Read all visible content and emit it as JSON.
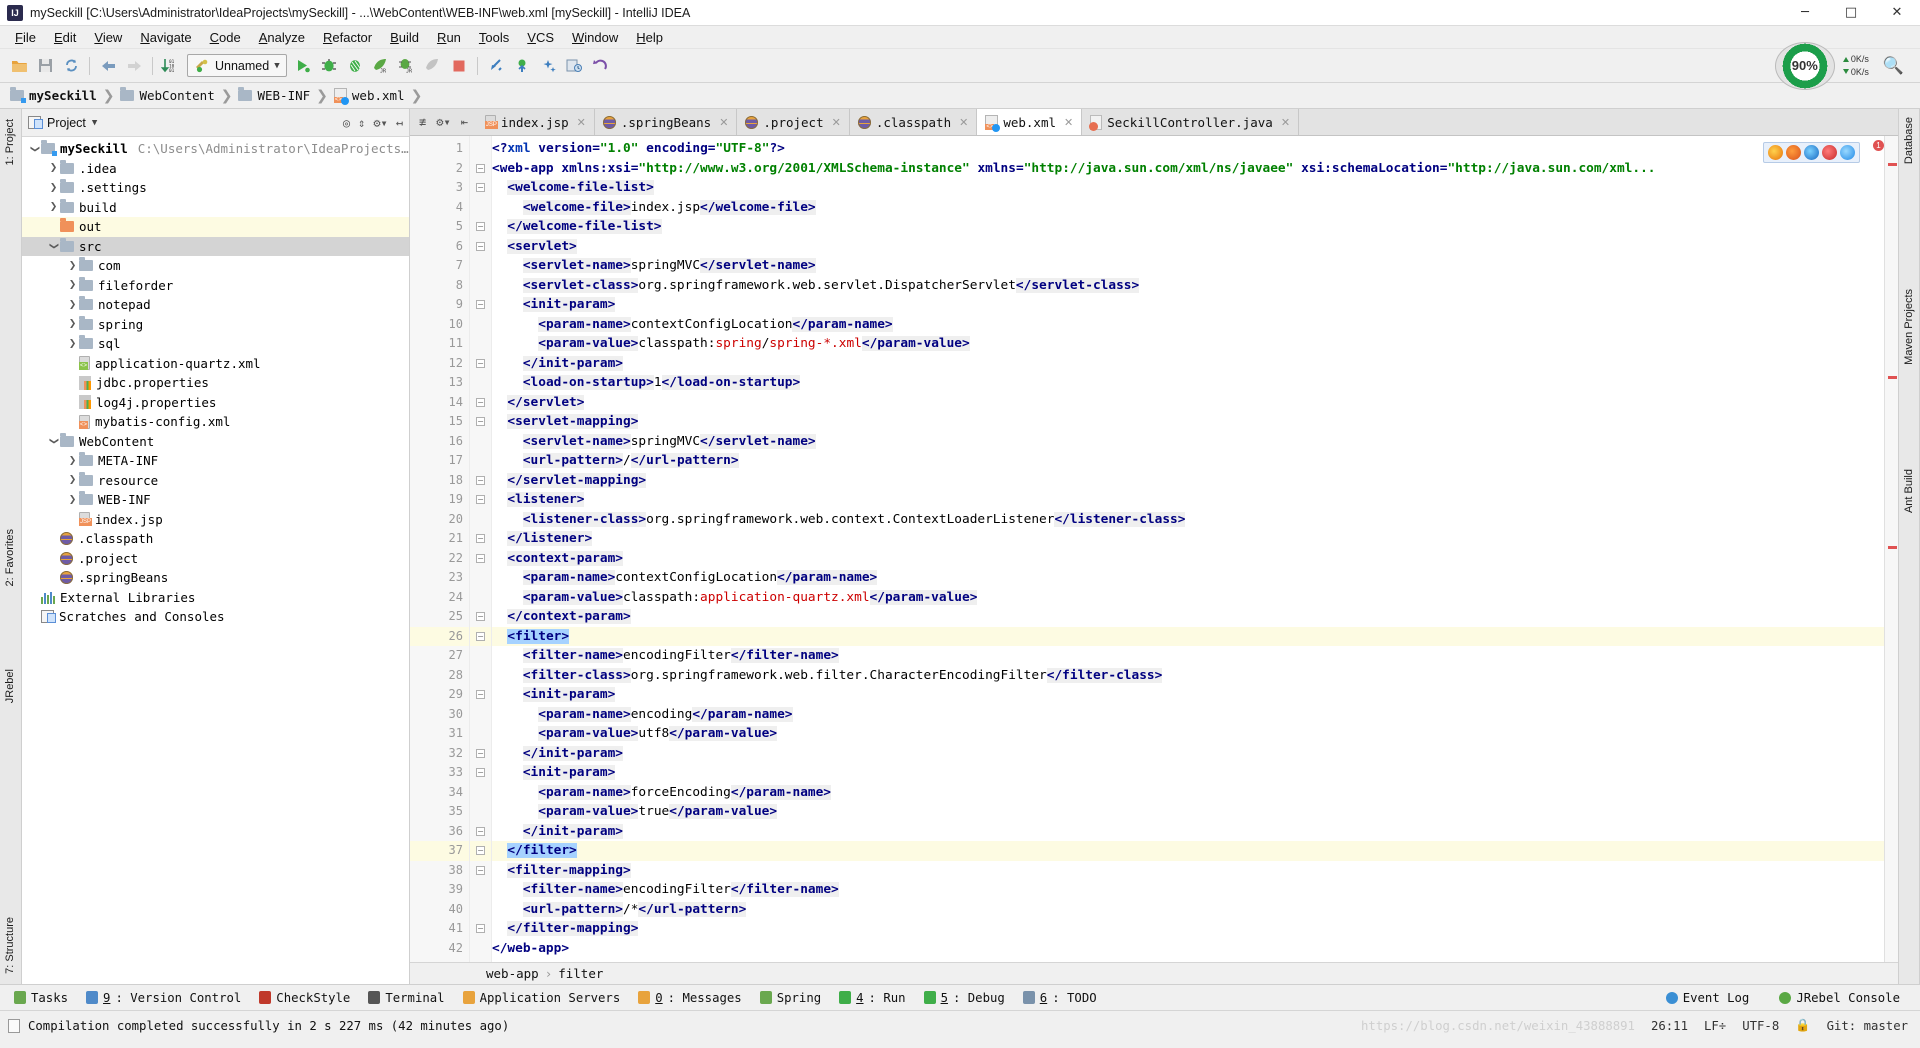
{
  "window": {
    "title": "mySeckill [C:\\Users\\Administrator\\IdeaProjects\\mySeckill] - ...\\WebContent\\WEB-INF\\web.xml [mySeckill] - IntelliJ IDEA",
    "app_icon": "IJ",
    "minimize": "─",
    "maximize": "□",
    "close": "✕"
  },
  "menu": [
    "File",
    "Edit",
    "View",
    "Navigate",
    "Code",
    "Analyze",
    "Refactor",
    "Build",
    "Run",
    "Tools",
    "VCS",
    "Window",
    "Help"
  ],
  "toolbar": {
    "icons": [
      "open-folder-icon",
      "save-all-icon",
      "sync-icon",
      "back-arrow-icon",
      "forward-arrow-icon",
      "sort-icon"
    ],
    "run_config": "Unnamed",
    "run_icons": [
      "run-icon",
      "debug-icon",
      "coverage-icon",
      "jrebel-run-icon",
      "jrebel-debug-icon",
      "profile-icon",
      "stop-icon"
    ],
    "vcs_icons": [
      "update-project-icon",
      "commit-icon",
      "diff-icon",
      "revision-icon",
      "rollback-icon"
    ],
    "meter_label": "90%",
    "net_up": "0K/s",
    "net_down": "0K/s",
    "search_icon": "search-icon"
  },
  "breadcrumb": [
    {
      "label": "mySeckill",
      "icon": "module-folder-icon"
    },
    {
      "label": "WebContent",
      "icon": "folder-icon"
    },
    {
      "label": "WEB-INF",
      "icon": "folder-icon"
    },
    {
      "label": "web.xml",
      "icon": "web-xml-icon"
    }
  ],
  "left_strip": {
    "project": "1: Project",
    "favorites": "2: Favorites",
    "jrebel": "JRebel",
    "structure": "7: Structure"
  },
  "right_strip": {
    "database": "Database",
    "maven": "Maven Projects",
    "ant": "Ant Build"
  },
  "project_panel": {
    "title": "Project",
    "actions": [
      "locate-icon",
      "collapse-icon",
      "settings-icon",
      "hide-icon"
    ],
    "tree": [
      {
        "indent": 0,
        "arrow": "v",
        "icon": "module-folder-icon",
        "label": "mySeckill",
        "bold": true,
        "path": "C:\\Users\\Administrator\\IdeaProjects\\mySeckil",
        "state": "none"
      },
      {
        "indent": 1,
        "arrow": ">",
        "icon": "folder-icon",
        "label": ".idea",
        "state": "none"
      },
      {
        "indent": 1,
        "arrow": ">",
        "icon": "folder-icon",
        "label": ".settings",
        "state": "none"
      },
      {
        "indent": 1,
        "arrow": ">",
        "icon": "folder-icon",
        "label": "build",
        "state": "none"
      },
      {
        "indent": 1,
        "arrow": "",
        "icon": "excluded-folder-icon",
        "label": "out",
        "state": "hl"
      },
      {
        "indent": 1,
        "arrow": "v",
        "icon": "source-folder-icon",
        "label": "src",
        "state": "sel"
      },
      {
        "indent": 2,
        "arrow": ">",
        "icon": "folder-icon",
        "label": "com",
        "state": "none"
      },
      {
        "indent": 2,
        "arrow": ">",
        "icon": "folder-icon",
        "label": "fileforder",
        "state": "none"
      },
      {
        "indent": 2,
        "arrow": ">",
        "icon": "folder-icon",
        "label": "notepad",
        "state": "none"
      },
      {
        "indent": 2,
        "arrow": ">",
        "icon": "folder-icon",
        "label": "spring",
        "state": "none"
      },
      {
        "indent": 2,
        "arrow": ">",
        "icon": "folder-icon",
        "label": "sql",
        "state": "none"
      },
      {
        "indent": 2,
        "arrow": "",
        "icon": "spring-xml-icon",
        "label": "application-quartz.xml",
        "state": "none"
      },
      {
        "indent": 2,
        "arrow": "",
        "icon": "properties-icon",
        "label": "jdbc.properties",
        "state": "none"
      },
      {
        "indent": 2,
        "arrow": "",
        "icon": "properties-icon",
        "label": "log4j.properties",
        "state": "none"
      },
      {
        "indent": 2,
        "arrow": "",
        "icon": "xml-icon",
        "label": "mybatis-config.xml",
        "state": "none"
      },
      {
        "indent": 1,
        "arrow": "v",
        "icon": "folder-icon",
        "label": "WebContent",
        "state": "none"
      },
      {
        "indent": 2,
        "arrow": ">",
        "icon": "folder-icon",
        "label": "META-INF",
        "state": "none"
      },
      {
        "indent": 2,
        "arrow": ">",
        "icon": "folder-icon",
        "label": "resource",
        "state": "none"
      },
      {
        "indent": 2,
        "arrow": ">",
        "icon": "folder-icon",
        "label": "WEB-INF",
        "state": "none"
      },
      {
        "indent": 2,
        "arrow": "",
        "icon": "jsp-icon",
        "label": "index.jsp",
        "state": "none"
      },
      {
        "indent": 1,
        "arrow": "",
        "icon": "eclipse-icon",
        "label": ".classpath",
        "state": "none"
      },
      {
        "indent": 1,
        "arrow": "",
        "icon": "eclipse-icon",
        "label": ".project",
        "state": "none"
      },
      {
        "indent": 1,
        "arrow": "",
        "icon": "eclipse-icon",
        "label": ".springBeans",
        "state": "none"
      },
      {
        "indent": 0,
        "arrow": "",
        "icon": "libraries-icon",
        "label": "External Libraries",
        "state": "none"
      },
      {
        "indent": 0,
        "arrow": "",
        "icon": "scratches-icon",
        "label": "Scratches and Consoles",
        "state": "none"
      }
    ]
  },
  "tabs": [
    {
      "label": "index.jsp",
      "icon": "jsp-icon",
      "active": false
    },
    {
      "label": ".springBeans",
      "icon": "eclipse-icon",
      "active": false
    },
    {
      "label": ".project",
      "icon": "eclipse-icon",
      "active": false
    },
    {
      "label": ".classpath",
      "icon": "eclipse-icon",
      "active": false
    },
    {
      "label": "web.xml",
      "icon": "web-xml-icon",
      "active": true
    },
    {
      "label": "SeckillController.java",
      "icon": "java-icon",
      "active": false
    }
  ],
  "editor": {
    "first_line": 1,
    "last_line": 42,
    "highlighted_lines": [
      26,
      37
    ],
    "error_count_badge": "1",
    "lines": [
      {
        "n": 1,
        "fold": false,
        "html": "<span class='tg'>&lt;?</span><span class='kw'>xml </span><span class='at'>version</span><span class='tg'>=</span><span class='av'>\"1.0\"</span> <span class='at'>encoding</span><span class='tg'>=</span><span class='av'>\"UTF-8\"</span><span class='tg'>?&gt;</span>",
        "text": "<?xml version=\"1.0\" encoding=\"UTF-8\"?>"
      },
      {
        "n": 2,
        "fold": true,
        "html": "<span class='tg'>&lt;web-app</span> <span class='at'>xmlns:xsi</span><span class='tg'>=</span><span class='av'>\"http://www.w3.org/2001/XMLSchema-instance\"</span> <span class='at'>xmlns</span><span class='tg'>=</span><span class='av'>\"http://java.sun.com/xml/ns/javaee\"</span> <span class='at'>xsi:schemaLocation</span><span class='tg'>=</span><span class='av'>\"http://java.sun.com/xml...</span>",
        "text": "<web-app xmlns:xsi=\"http://www.w3.org/2001/XMLSchema-instance\" xmlns=\"http://java.sun.com/xml/ns/javaee\" xsi:schemaLocation=\"http://java.sun.com/xml..."
      },
      {
        "n": 3,
        "fold": true,
        "html": "  <span class='tg bgs'>&lt;welcome-file-list&gt;</span>",
        "text": "  <welcome-file-list>"
      },
      {
        "n": 4,
        "fold": false,
        "html": "    <span class='tg bgs'>&lt;welcome-file&gt;</span><span class='tx'>index.jsp</span><span class='tg bgs'>&lt;/welcome-file&gt;</span>",
        "text": "    <welcome-file>index.jsp</welcome-file>"
      },
      {
        "n": 5,
        "fold": true,
        "html": "  <span class='tg bgs'>&lt;/welcome-file-list&gt;</span>",
        "text": "  </welcome-file-list>"
      },
      {
        "n": 6,
        "fold": true,
        "html": "  <span class='tg bgs'>&lt;servlet&gt;</span>",
        "text": "  <servlet>"
      },
      {
        "n": 7,
        "fold": false,
        "html": "    <span class='tg bgs'>&lt;servlet-name&gt;</span><span class='tx'>springMVC</span><span class='tg bgs'>&lt;/servlet-name&gt;</span>",
        "text": "    <servlet-name>springMVC</servlet-name>"
      },
      {
        "n": 8,
        "fold": false,
        "html": "    <span class='tg bgs'>&lt;servlet-class&gt;</span><span class='tx'>org.springframework.web.servlet.DispatcherServlet</span><span class='tg bgs'>&lt;/servlet-class&gt;</span>",
        "text": "    <servlet-class>org.springframework.web.servlet.DispatcherServlet</servlet-class>"
      },
      {
        "n": 9,
        "fold": true,
        "html": "    <span class='tg bgs'>&lt;init-param&gt;</span>",
        "text": "    <init-param>"
      },
      {
        "n": 10,
        "fold": false,
        "html": "      <span class='tg bgs'>&lt;param-name&gt;</span><span class='tx'>contextConfigLocation</span><span class='tg bgs'>&lt;/param-name&gt;</span>",
        "text": "      <param-name>contextConfigLocation</param-name>"
      },
      {
        "n": 11,
        "fold": false,
        "html": "      <span class='tg bgs'>&lt;param-value&gt;</span><span class='tx'>classpath:</span><span class='rd'>spring</span><span class='tx'>/</span><span class='rd'>spring-*.xml</span><span class='tg bgs'>&lt;/param-value&gt;</span>",
        "text": "      <param-value>classpath:spring/spring-*.xml</param-value>"
      },
      {
        "n": 12,
        "fold": true,
        "html": "    <span class='tg bgs'>&lt;/init-param&gt;</span>",
        "text": "    </init-param>"
      },
      {
        "n": 13,
        "fold": false,
        "html": "    <span class='tg bgs'>&lt;load-on-startup&gt;</span><span class='tx'>1</span><span class='tg bgs'>&lt;/load-on-startup&gt;</span>",
        "text": "    <load-on-startup>1</load-on-startup>"
      },
      {
        "n": 14,
        "fold": true,
        "html": "  <span class='tg bgs'>&lt;/servlet&gt;</span>",
        "text": "  </servlet>"
      },
      {
        "n": 15,
        "fold": true,
        "html": "  <span class='tg bgs'>&lt;servlet-mapping&gt;</span>",
        "text": "  <servlet-mapping>"
      },
      {
        "n": 16,
        "fold": false,
        "html": "    <span class='tg bgs'>&lt;servlet-name&gt;</span><span class='tx'>springMVC</span><span class='tg bgs'>&lt;/servlet-name&gt;</span>",
        "text": "    <servlet-name>springMVC</servlet-name>"
      },
      {
        "n": 17,
        "fold": false,
        "html": "    <span class='tg bgs'>&lt;url-pattern&gt;</span><span class='tx'>/</span><span class='tg bgs'>&lt;/url-pattern&gt;</span>",
        "text": "    <url-pattern>/</url-pattern>"
      },
      {
        "n": 18,
        "fold": true,
        "html": "  <span class='tg bgs'>&lt;/servlet-mapping&gt;</span>",
        "text": "  </servlet-mapping>"
      },
      {
        "n": 19,
        "fold": true,
        "html": "  <span class='tg bgs'>&lt;listener&gt;</span>",
        "text": "  <listener>"
      },
      {
        "n": 20,
        "fold": false,
        "html": "    <span class='tg bgs'>&lt;listener-class&gt;</span><span class='tx'>org.springframework.web.context.ContextLoaderListener</span><span class='tg bgs'>&lt;/listener-class&gt;</span>",
        "text": "    <listener-class>org.springframework.web.context.ContextLoaderListener</listener-class>"
      },
      {
        "n": 21,
        "fold": true,
        "html": "  <span class='tg bgs'>&lt;/listener&gt;</span>",
        "text": "  </listener>"
      },
      {
        "n": 22,
        "fold": true,
        "html": "  <span class='tg bgs'>&lt;context-param&gt;</span>",
        "text": "  <context-param>"
      },
      {
        "n": 23,
        "fold": false,
        "html": "    <span class='tg bgs'>&lt;param-name&gt;</span><span class='tx'>contextConfigLocation</span><span class='tg bgs'>&lt;/param-name&gt;</span>",
        "text": "    <param-name>contextConfigLocation</param-name>"
      },
      {
        "n": 24,
        "fold": false,
        "html": "    <span class='tg bgs'>&lt;param-value&gt;</span><span class='tx'>classpath:</span><span class='rd'>application-quartz.xml</span><span class='tg bgs'>&lt;/param-value&gt;</span>",
        "text": "    <param-value>classpath:application-quartz.xml</param-value>"
      },
      {
        "n": 25,
        "fold": true,
        "html": "  <span class='tg bgs'>&lt;/context-param&gt;</span>",
        "text": "  </context-param>"
      },
      {
        "n": 26,
        "fold": true,
        "html": "  <span class='tg selblue'>&lt;filter&gt;</span>",
        "text": "  <filter>"
      },
      {
        "n": 27,
        "fold": false,
        "html": "    <span class='tg bgs'>&lt;filter-name&gt;</span><span class='tx'>encodingFilter</span><span class='tg bgs'>&lt;/filter-name&gt;</span>",
        "text": "    <filter-name>encodingFilter</filter-name>"
      },
      {
        "n": 28,
        "fold": false,
        "html": "    <span class='tg bgs'>&lt;filter-class&gt;</span><span class='tx'>org.springframework.web.filter.CharacterEncodingFilter</span><span class='tg bgs'>&lt;/filter-class&gt;</span>",
        "text": "    <filter-class>org.springframework.web.filter.CharacterEncodingFilter</filter-class>"
      },
      {
        "n": 29,
        "fold": true,
        "html": "    <span class='tg bgs'>&lt;init-param&gt;</span>",
        "text": "    <init-param>"
      },
      {
        "n": 30,
        "fold": false,
        "html": "      <span class='tg bgs'>&lt;param-name&gt;</span><span class='tx'>encoding</span><span class='tg bgs'>&lt;/param-name&gt;</span>",
        "text": "      <param-name>encoding</param-name>"
      },
      {
        "n": 31,
        "fold": false,
        "html": "      <span class='tg bgs'>&lt;param-value&gt;</span><span class='tx'>utf8</span><span class='tg bgs'>&lt;/param-value&gt;</span>",
        "text": "      <param-value>utf8</param-value>"
      },
      {
        "n": 32,
        "fold": true,
        "html": "    <span class='tg bgs'>&lt;/init-param&gt;</span>",
        "text": "    </init-param>"
      },
      {
        "n": 33,
        "fold": true,
        "html": "    <span class='tg bgs'>&lt;init-param&gt;</span>",
        "text": "    <init-param>"
      },
      {
        "n": 34,
        "fold": false,
        "html": "      <span class='tg bgs'>&lt;param-name&gt;</span><span class='tx'>forceEncoding</span><span class='tg bgs'>&lt;/param-name&gt;</span>",
        "text": "      <param-name>forceEncoding</param-name>"
      },
      {
        "n": 35,
        "fold": false,
        "html": "      <span class='tg bgs'>&lt;param-value&gt;</span><span class='tx'>true</span><span class='tg bgs'>&lt;/param-value&gt;</span>",
        "text": "      <param-value>true</param-value>"
      },
      {
        "n": 36,
        "fold": true,
        "html": "    <span class='tg bgs'>&lt;/init-param&gt;</span>",
        "text": "    </init-param>"
      },
      {
        "n": 37,
        "fold": true,
        "html": "  <span class='tg selblue'>&lt;/filter&gt;</span>",
        "text": "  </filter>"
      },
      {
        "n": 38,
        "fold": true,
        "html": "  <span class='tg bgs'>&lt;filter-mapping&gt;</span>",
        "text": "  <filter-mapping>"
      },
      {
        "n": 39,
        "fold": false,
        "html": "    <span class='tg bgs'>&lt;filter-name&gt;</span><span class='tx'>encodingFilter</span><span class='tg bgs'>&lt;/filter-name&gt;</span>",
        "text": "    <filter-name>encodingFilter</filter-name>"
      },
      {
        "n": 40,
        "fold": false,
        "html": "    <span class='tg bgs'>&lt;url-pattern&gt;</span><span class='tx'>/*</span><span class='tg bgs'>&lt;/url-pattern&gt;</span>",
        "text": "    <url-pattern>/*</url-pattern>"
      },
      {
        "n": 41,
        "fold": true,
        "html": "  <span class='tg bgs'>&lt;/filter-mapping&gt;</span>",
        "text": "  </filter-mapping>"
      },
      {
        "n": 42,
        "fold": false,
        "html": "<span class='tg'>&lt;/web-app&gt;</span>",
        "text": "</web-app>"
      }
    ]
  },
  "sub_breadcrumb": [
    "web-app",
    "filter"
  ],
  "tool_windows": [
    {
      "label": "Tasks",
      "num": "",
      "icon": "tasks-icon"
    },
    {
      "label": ": Version Control",
      "num": "9",
      "icon": "vcs-icon"
    },
    {
      "label": "CheckStyle",
      "num": "",
      "icon": "checkstyle-icon"
    },
    {
      "label": "Terminal",
      "num": "",
      "icon": "terminal-icon"
    },
    {
      "label": "Application Servers",
      "num": "",
      "icon": "app-servers-icon"
    },
    {
      "label": ": Messages",
      "num": "0",
      "icon": "messages-icon"
    },
    {
      "label": "Spring",
      "num": "",
      "icon": "spring-icon"
    },
    {
      "label": ": Run",
      "num": "4",
      "icon": "run-icon"
    },
    {
      "label": ": Debug",
      "num": "5",
      "icon": "debug-icon"
    },
    {
      "label": ": TODO",
      "num": "6",
      "icon": "todo-icon"
    }
  ],
  "tool_windows_right": [
    {
      "label": "Event Log",
      "icon": "event-log-icon"
    },
    {
      "label": "JRebel Console",
      "icon": "jrebel-icon"
    }
  ],
  "status_bar": {
    "message": "Compilation completed successfully in 2 s 227 ms (42 minutes ago)",
    "url_hint": "https://blog.csdn.net/weixin_43888891",
    "caret": "26:11",
    "line_sep": "LF÷",
    "encoding": "UTF-8",
    "git_branch": "Git: master",
    "lock_icon": "lock-icon"
  },
  "colors": {
    "accent_blue": "#2675bf",
    "tag_navy": "#000080",
    "attr_value_green": "#008000",
    "string_red": "#cc0000",
    "selection_blue": "#a6d2ff",
    "highlight_yellow": "#fdfbe2",
    "panel_gray": "#f0f0f0"
  }
}
